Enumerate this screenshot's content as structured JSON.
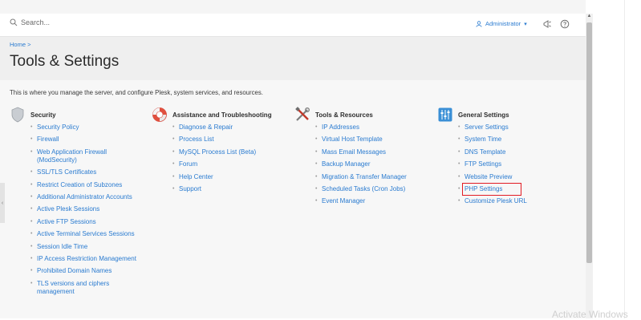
{
  "topbar": {
    "search_placeholder": "Search...",
    "user_label": "Administrator",
    "user_chevron": "▾"
  },
  "header": {
    "breadcrumb": "Home >",
    "title": "Tools & Settings"
  },
  "intro": "This is where you manage the server, and configure Plesk, system services, and resources.",
  "sections": [
    {
      "title": "Security",
      "icon": "shield-icon",
      "items": [
        "Security Policy",
        "Firewall",
        "Web Application Firewall (ModSecurity)",
        "SSL/TLS Certificates",
        "Restrict Creation of Subzones",
        "Additional Administrator Accounts",
        "Active Plesk Sessions",
        "Active FTP Sessions",
        "Active Terminal Services Sessions",
        "Session Idle Time",
        "IP Access Restriction Management",
        "Prohibited Domain Names",
        "TLS versions and ciphers management"
      ]
    },
    {
      "title": "Assistance and Troubleshooting",
      "icon": "lifebuoy-icon",
      "items": [
        "Diagnose & Repair",
        "Process List",
        "MySQL Process List (Beta)",
        "Forum",
        "Help Center",
        "Support"
      ]
    },
    {
      "title": "Tools & Resources",
      "icon": "tools-icon",
      "items": [
        "IP Addresses",
        "Virtual Host Template",
        "Mass Email Messages",
        "Backup Manager",
        "Migration & Transfer Manager",
        "Scheduled Tasks (Cron Jobs)",
        "Event Manager"
      ]
    },
    {
      "title": "General Settings",
      "icon": "settings-panel-icon",
      "items": [
        "Server Settings",
        "System Time",
        "DNS Template",
        "FTP Settings",
        "Website Preview",
        "PHP Settings",
        "Customize Plesk URL"
      ]
    }
  ],
  "colors": {
    "link": "#2a7bd0",
    "highlight_box": "#e21b23"
  },
  "watermark": "Activate Windows"
}
